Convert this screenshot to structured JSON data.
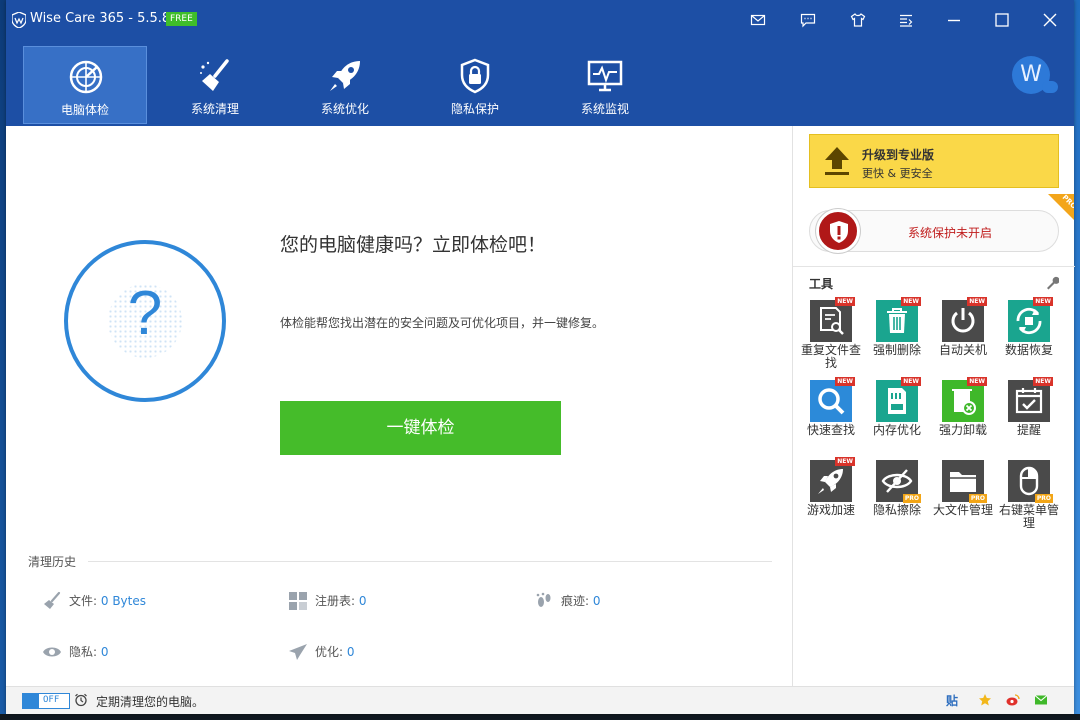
{
  "window": {
    "title": "Wise Care 365 - 5.5.8",
    "badge": "FREE",
    "buttons": [
      "mail-icon",
      "feedback-icon",
      "skin-icon",
      "menu-icon",
      "minimize-icon",
      "maximize-icon",
      "close-icon"
    ]
  },
  "nav": {
    "items": [
      {
        "label": "电脑体检",
        "icon": "radar-icon",
        "active": true
      },
      {
        "label": "系统清理",
        "icon": "broom-icon"
      },
      {
        "label": "系统优化",
        "icon": "rocket-icon"
      },
      {
        "label": "隐私保护",
        "icon": "lock-shield-icon"
      },
      {
        "label": "系统监视",
        "icon": "monitor-icon"
      }
    ],
    "avatar": "W"
  },
  "main": {
    "headline": "您的电脑健康吗？立即体检吧！",
    "subline": "体检能帮您找出潜在的安全问题及可优化项目，并一键修复。",
    "scan_button": "一键体检",
    "circle_glyph": "?"
  },
  "history": {
    "title": "清理历史",
    "items": [
      {
        "label": "文件:",
        "value": "0 Bytes",
        "icon": "broom-icon"
      },
      {
        "label": "注册表:",
        "value": "0",
        "icon": "registry-icon"
      },
      {
        "label": "痕迹:",
        "value": "0",
        "icon": "footprint-icon"
      },
      {
        "label": "隐私:",
        "value": "0",
        "icon": "eye-icon"
      },
      {
        "label": "优化:",
        "value": "0",
        "icon": "paper-plane-icon"
      }
    ]
  },
  "side": {
    "upgrade_title": "升级到专业版",
    "upgrade_sub": "更快 & 更安全",
    "protect_text": "系统保护未开启",
    "pro_corner": "PRO",
    "tools_title": "工具",
    "tools": [
      {
        "label": "重复文件查找",
        "tag": "NEW",
        "color": "#4a4a4a"
      },
      {
        "label": "强制删除",
        "tag": "NEW",
        "color": "#1aa58f"
      },
      {
        "label": "自动关机",
        "tag": "NEW",
        "color": "#4a4a4a"
      },
      {
        "label": "数据恢复",
        "tag": "NEW",
        "color": "#1aa58f"
      },
      {
        "label": "快速查找",
        "tag": "NEW",
        "color": "#2c8ad9"
      },
      {
        "label": "内存优化",
        "tag": "NEW",
        "color": "#1aa58f"
      },
      {
        "label": "强力卸载",
        "tag": "NEW",
        "color": "#3fb82a"
      },
      {
        "label": "提醒",
        "tag": "NEW",
        "color": "#4a4a4a"
      },
      {
        "label": "游戏加速",
        "tag": "NEW",
        "color": "#4a4a4a"
      },
      {
        "label": "隐私擦除",
        "tag": "PRO",
        "color": "#4a4a4a"
      },
      {
        "label": "大文件管理",
        "tag": "PRO",
        "color": "#4a4a4a"
      },
      {
        "label": "右键菜单管理",
        "tag": "PRO",
        "color": "#4a4a4a"
      }
    ]
  },
  "bottom": {
    "toggle_state": "OFF",
    "schedule_text": "定期清理您的电脑。",
    "share_label": "贴"
  },
  "colors": {
    "brand_blue": "#1d4fa5",
    "accent_blue": "#2f87d8",
    "scan_green": "#45bc2a",
    "upgrade_yellow": "#fad848",
    "alert_red": "#b01818"
  }
}
